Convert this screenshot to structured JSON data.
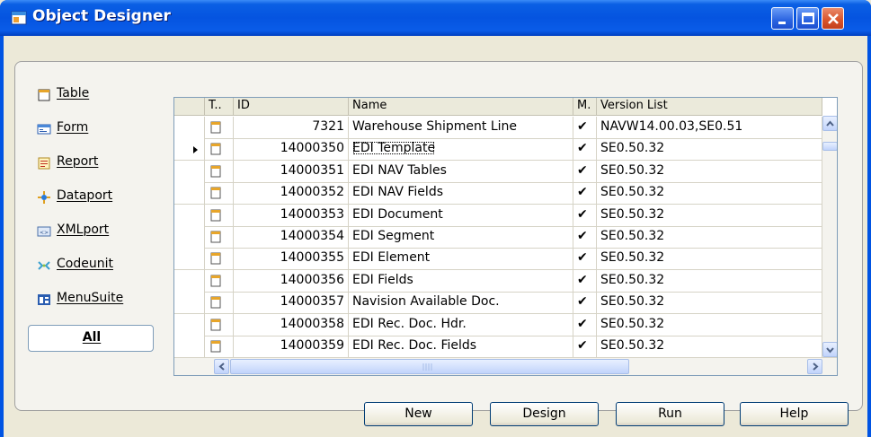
{
  "window": {
    "title": "Object Designer"
  },
  "object_types": [
    {
      "label": "Table",
      "icon": "table-icon"
    },
    {
      "label": "Form",
      "icon": "form-icon"
    },
    {
      "label": "Report",
      "icon": "report-icon"
    },
    {
      "label": "Dataport",
      "icon": "dataport-icon"
    },
    {
      "label": "XMLport",
      "icon": "xmlport-icon"
    },
    {
      "label": "Codeunit",
      "icon": "codeunit-icon"
    },
    {
      "label": "MenuSuite",
      "icon": "menusuite-icon"
    },
    {
      "label": "All",
      "icon": ""
    }
  ],
  "grid": {
    "headers": {
      "type": "T..",
      "id": "ID",
      "name": "Name",
      "modified": "M.",
      "version": "Version List"
    },
    "rows": [
      {
        "id": "7321",
        "name": "Warehouse Shipment Line",
        "modified": "✔",
        "version": "NAVW14.00.03,SE0.51"
      },
      {
        "id": "14000350",
        "name": "EDI Template",
        "modified": "✔",
        "version": "SE0.50.32",
        "current": true
      },
      {
        "id": "14000351",
        "name": "EDI NAV Tables",
        "modified": "✔",
        "version": "SE0.50.32"
      },
      {
        "id": "14000352",
        "name": "EDI NAV Fields",
        "modified": "✔",
        "version": "SE0.50.32"
      },
      {
        "id": "14000353",
        "name": "EDI Document",
        "modified": "✔",
        "version": "SE0.50.32"
      },
      {
        "id": "14000354",
        "name": "EDI Segment",
        "modified": "✔",
        "version": "SE0.50.32"
      },
      {
        "id": "14000355",
        "name": "EDI Element",
        "modified": "✔",
        "version": "SE0.50.32"
      },
      {
        "id": "14000356",
        "name": "EDI Fields",
        "modified": "✔",
        "version": "SE0.50.32"
      },
      {
        "id": "14000357",
        "name": "Navision Available Doc.",
        "modified": "✔",
        "version": "SE0.50.32"
      },
      {
        "id": "14000358",
        "name": "EDI Rec. Doc. Hdr.",
        "modified": "✔",
        "version": "SE0.50.32"
      },
      {
        "id": "14000359",
        "name": "EDI Rec. Doc. Fields",
        "modified": "✔",
        "version": "SE0.50.32"
      }
    ]
  },
  "buttons": {
    "new": "New",
    "design": "Design",
    "run": "Run",
    "help": "Help"
  },
  "colors": {
    "title_bar": "#0554e0",
    "window_bg": "#ece9d8",
    "grid_border": "#7f9db9"
  }
}
